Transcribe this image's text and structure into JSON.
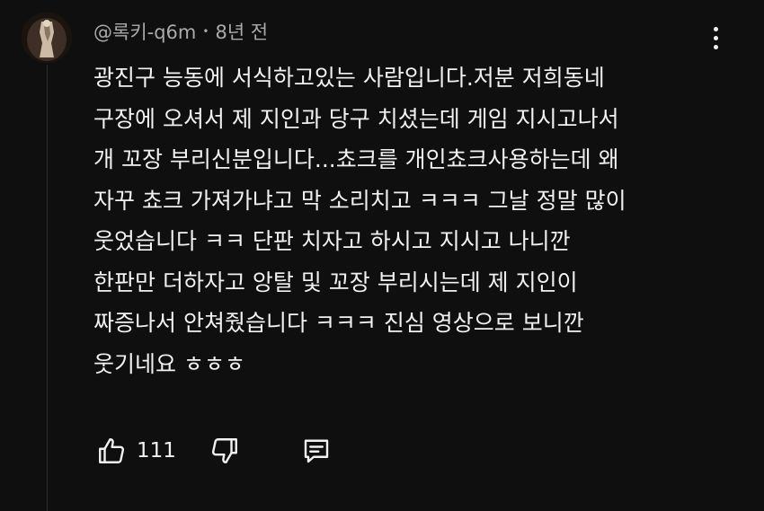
{
  "comment": {
    "author": "@록키-q6m",
    "separator": "•",
    "time": "8년 전",
    "lines": [
      "광진구 능동에 서식하고있는 사람입니다.저분 저희동네",
      "구장에 오셔서 제 지인과 당구 치셨는데 게임 지시고나서",
      "개 꼬장 부리신분입니다...쵸크를 개인쵸크사용하는데 왜",
      "자꾸 쵸크 가져가냐고 막 소리치고 ㅋㅋㅋ 그날 정말 많이",
      "웃었습니다 ㅋㅋ 단판 치자고 하시고 지시고 나니깐",
      "한판만 더하자고 앙탈 및 꼬장 부리시는데 제 지인이",
      "짜증나서 안쳐줬습니다 ㅋㅋㅋ 진심 영상으로 보니깐",
      "웃기네요 ㅎㅎㅎ"
    ],
    "like_count": "111"
  },
  "icons": {
    "avatar": "avatar",
    "menu": "more-vertical-icon",
    "like": "thumbs-up-icon",
    "dislike": "thumbs-down-icon",
    "reply": "comment-icon"
  },
  "colors": {
    "background": "#0f0f0f",
    "text_primary": "#f1f1f1",
    "text_secondary": "#aaaaaa"
  }
}
